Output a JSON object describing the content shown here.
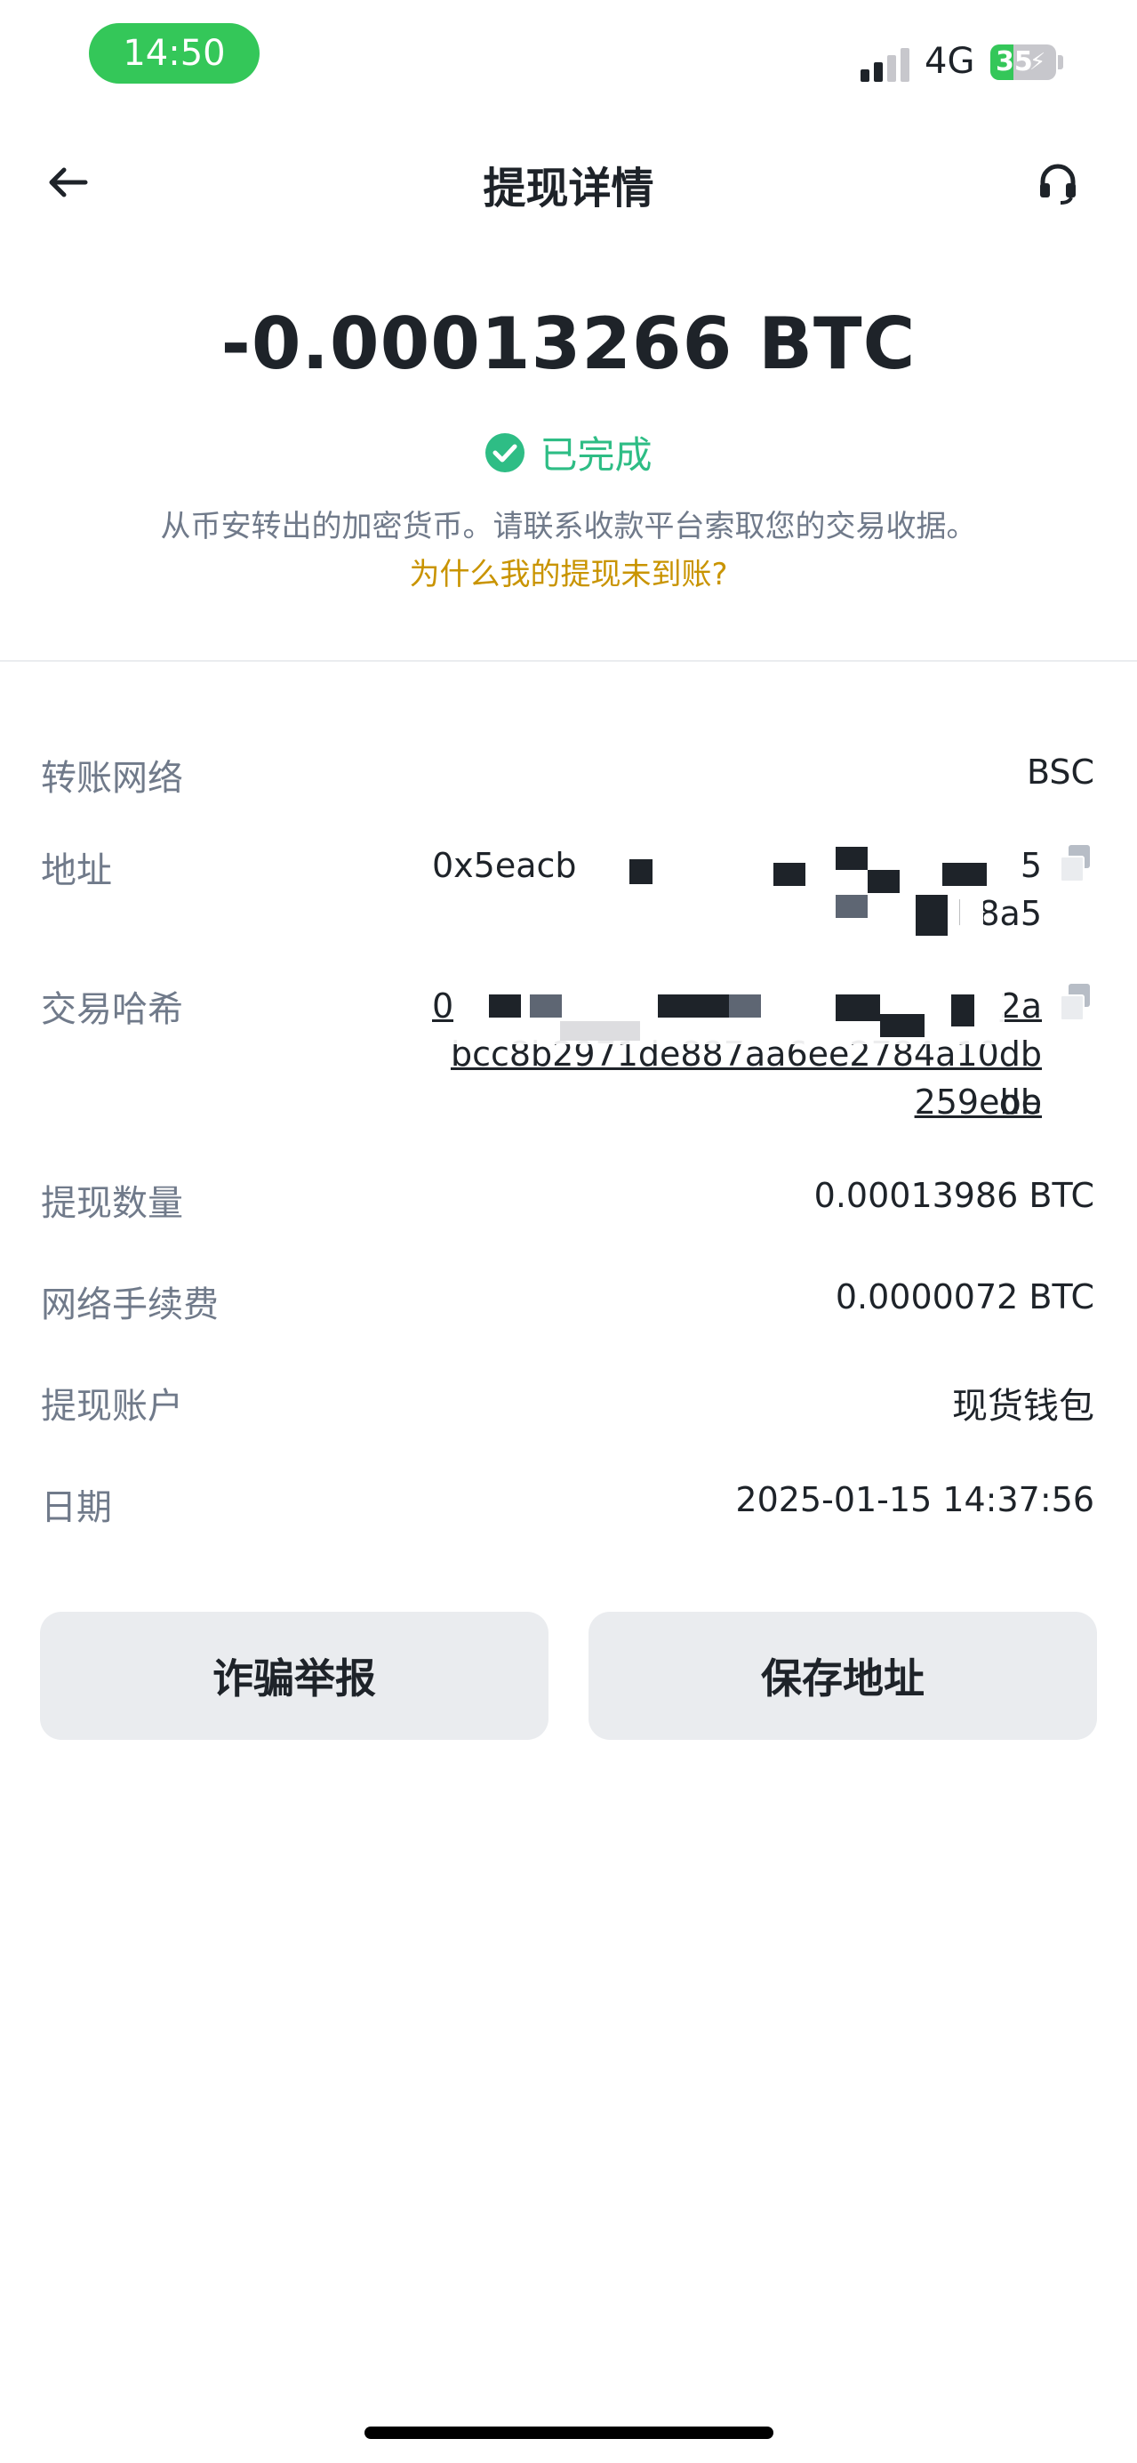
{
  "status_bar": {
    "time": "14:50",
    "network": "4G",
    "battery_percent": "35",
    "battery_level": 35,
    "colors": {
      "time_pill": "#34c759"
    }
  },
  "header": {
    "title": "提现详情",
    "back_icon": "arrow-left-icon",
    "support_icon": "headset-icon"
  },
  "summary": {
    "amount": "-0.00013266 BTC",
    "status": "已完成",
    "status_icon": "check-circle-icon",
    "description": "从币安转出的加密货币。请联系收款平台索取您的交易收据。",
    "help_link": "为什么我的提现未到账?",
    "colors": {
      "success": "#2ebd85",
      "link": "#c99400"
    }
  },
  "details": {
    "network": {
      "label": "转账网络",
      "value": "BSC"
    },
    "address": {
      "label": "地址",
      "line1": "0x5eacb7",
      "line1_end": "5",
      "line2": "b8a5"
    },
    "tx_hash": {
      "label": "交易哈希",
      "line1_start": "0",
      "line1_end": "2a",
      "line2": "bcc8b2971de887aa6ee2784a10dbdb",
      "line3": "259ebe"
    },
    "amount": {
      "label": "提现数量",
      "value": "0.00013986 BTC"
    },
    "fee": {
      "label": "网络手续费",
      "value": "0.0000072 BTC"
    },
    "account": {
      "label": "提现账户",
      "value": "现货钱包"
    },
    "date": {
      "label": "日期",
      "value": "2025-01-15 14:37:56"
    }
  },
  "actions": {
    "report_fraud": "诈骗举报",
    "save_address": "保存地址"
  }
}
